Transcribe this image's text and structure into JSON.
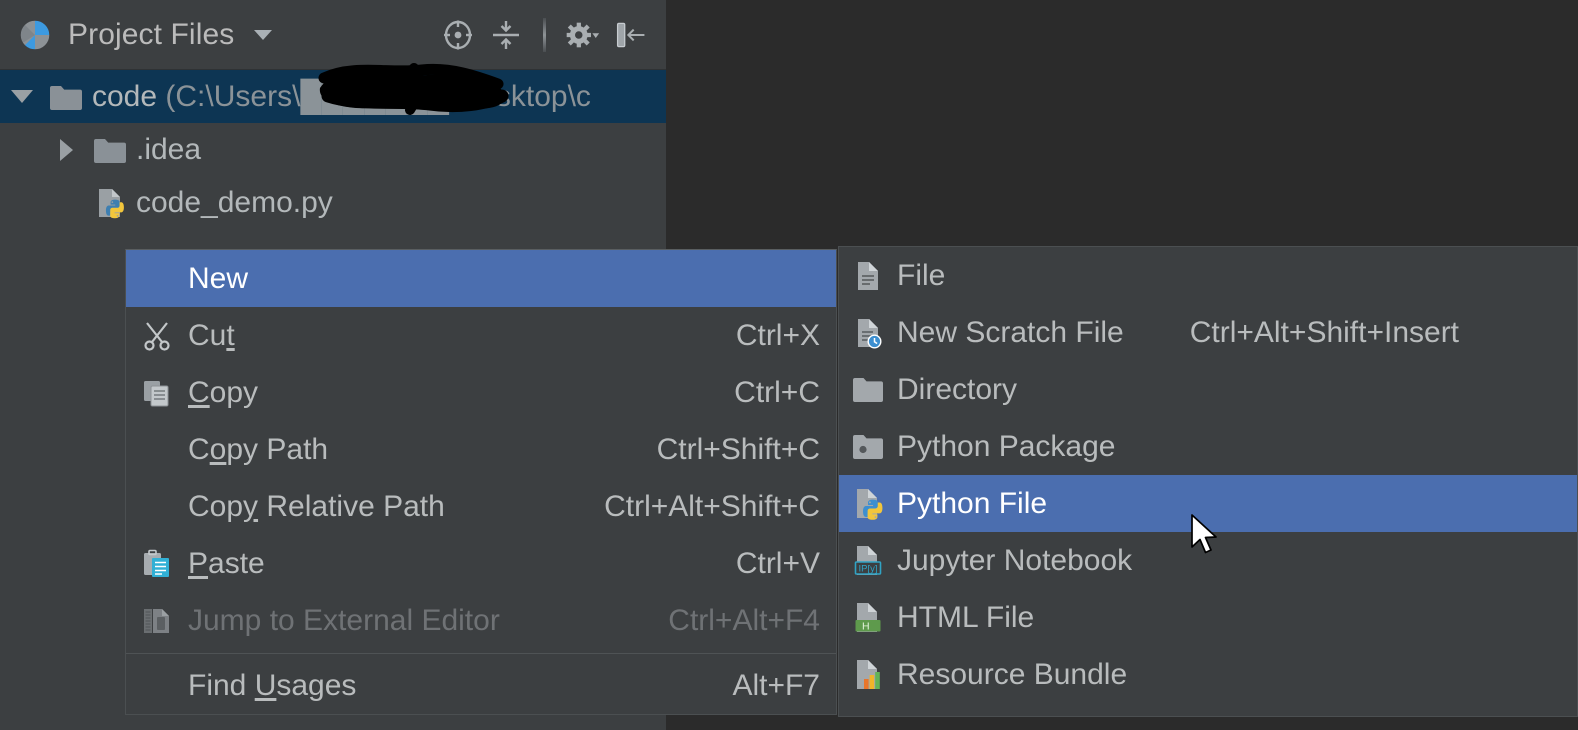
{
  "toolwindow": {
    "title": "Project Files",
    "icon": "project-files-pie-icon",
    "actions": [
      {
        "name": "select-opened-file-icon",
        "label": "Select Opened File"
      },
      {
        "name": "collapse-all-icon",
        "label": "Collapse All"
      },
      {
        "name": "settings-gear-icon",
        "label": "Settings"
      },
      {
        "name": "hide-panel-icon",
        "label": "Hide"
      }
    ]
  },
  "tree": {
    "items": [
      {
        "name": "code",
        "suffix": " (C:\\Users\\███████\\Desktop\\c",
        "icon": "folder-icon",
        "expanded": true,
        "selected": true,
        "depth": 0
      },
      {
        "name": ".idea",
        "suffix": "",
        "icon": "folder-icon",
        "expanded": false,
        "selected": false,
        "depth": 1
      },
      {
        "name": "code_demo.py",
        "suffix": "",
        "icon": "python-file-icon",
        "expanded": null,
        "selected": false,
        "depth": 1
      }
    ]
  },
  "context_menu": {
    "items": [
      {
        "label": "New",
        "shortcut": "",
        "icon": "",
        "mnemonic": "",
        "selected": true,
        "disabled": false,
        "submenu": true,
        "separator_after": false
      },
      {
        "label": "Cut",
        "shortcut": "Ctrl+X",
        "icon": "scissors-icon",
        "mnemonic": "t",
        "selected": false,
        "disabled": false,
        "submenu": false,
        "separator_after": false
      },
      {
        "label": "Copy",
        "shortcut": "Ctrl+C",
        "icon": "copy-icon",
        "mnemonic": "C",
        "selected": false,
        "disabled": false,
        "submenu": false,
        "separator_after": false
      },
      {
        "label": "Copy Path",
        "shortcut": "Ctrl+Shift+C",
        "icon": "",
        "mnemonic": "o",
        "selected": false,
        "disabled": false,
        "submenu": false,
        "separator_after": false
      },
      {
        "label": "Copy Relative Path",
        "shortcut": "Ctrl+Alt+Shift+C",
        "icon": "",
        "mnemonic": "y",
        "selected": false,
        "disabled": false,
        "submenu": false,
        "separator_after": false
      },
      {
        "label": "Paste",
        "shortcut": "Ctrl+V",
        "icon": "paste-icon",
        "mnemonic": "P",
        "selected": false,
        "disabled": false,
        "submenu": false,
        "separator_after": false
      },
      {
        "label": "Jump to External Editor",
        "shortcut": "Ctrl+Alt+F4",
        "icon": "external-file-icon",
        "mnemonic": "",
        "selected": false,
        "disabled": true,
        "submenu": false,
        "separator_after": true
      },
      {
        "label": "Find Usages",
        "shortcut": "Alt+F7",
        "icon": "",
        "mnemonic": "U",
        "selected": false,
        "disabled": false,
        "submenu": false,
        "separator_after": false
      }
    ]
  },
  "submenu": {
    "items": [
      {
        "label": "File",
        "shortcut": "",
        "icon": "file-icon",
        "selected": false,
        "separator_after": false
      },
      {
        "label": "New Scratch File",
        "shortcut": "Ctrl+Alt+Shift+Insert",
        "icon": "scratch-file-icon",
        "selected": false,
        "separator_after": false
      },
      {
        "label": "Directory",
        "shortcut": "",
        "icon": "folder-icon",
        "selected": false,
        "separator_after": false
      },
      {
        "label": "Python Package",
        "shortcut": "",
        "icon": "python-package-icon",
        "selected": false,
        "separator_after": false
      },
      {
        "label": "Python File",
        "shortcut": "",
        "icon": "python-file-icon",
        "selected": true,
        "separator_after": false
      },
      {
        "label": "Jupyter Notebook",
        "shortcut": "",
        "icon": "jupyter-icon",
        "selected": false,
        "separator_after": false
      },
      {
        "label": "HTML File",
        "shortcut": "",
        "icon": "html-file-icon",
        "selected": false,
        "separator_after": false
      },
      {
        "label": "Resource Bundle",
        "shortcut": "",
        "icon": "resource-bundle-icon",
        "selected": false,
        "separator_after": false
      }
    ]
  },
  "colors": {
    "toolwindow_bg": "#3c3f41",
    "editor_bg": "#2b2b2b",
    "menu_bg": "#3c3f41",
    "selection_blue": "#4b6eaf",
    "tree_selection": "#0d3553",
    "text": "#b9bcbd",
    "disabled_text": "#6f7275"
  }
}
